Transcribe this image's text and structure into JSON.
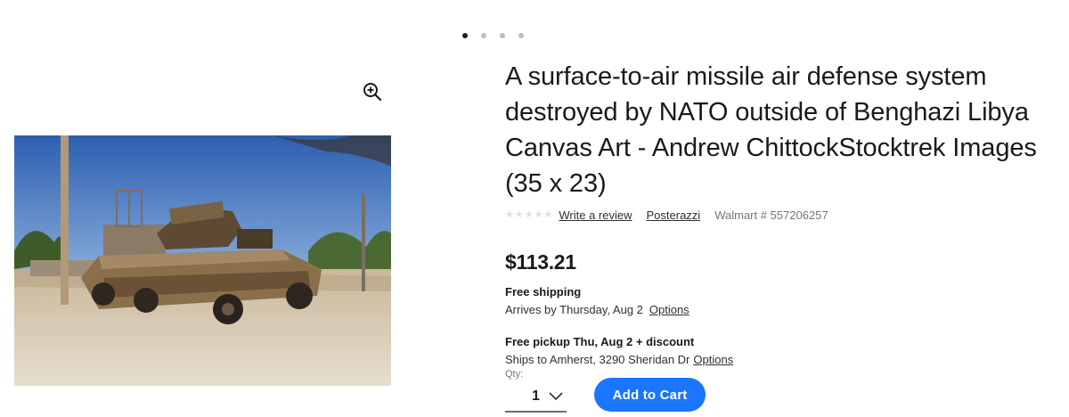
{
  "carousel": {
    "count": 4,
    "active_index": 0
  },
  "icons": {
    "zoom": "zoom-in-icon",
    "qty_chevron": "chevron-down-icon",
    "rating": "star-icon"
  },
  "product": {
    "title": "A surface-to-air missile air defense system destroyed by NATO outside of Benghazi Libya Canvas Art - Andrew ChittockStocktrek Images (35 x 23)",
    "rating_stars": 0,
    "write_review": "Write a review",
    "seller": "Posterazzi",
    "sku": "Walmart # 557206257",
    "price": "$113.21"
  },
  "shipping": {
    "label": "Free shipping",
    "arrives": "Arrives by Thursday, Aug 2",
    "options": "Options"
  },
  "pickup": {
    "label": "Free pickup Thu, Aug 2 + discount",
    "ships_to": "Ships to Amherst, 3290 Sheridan Dr",
    "options": "Options"
  },
  "quantity": {
    "label": "Qty:",
    "value": "1"
  },
  "cart": {
    "button": "Add to Cart"
  },
  "colors": {
    "accent": "#1a75ff",
    "text": "#2e2f32",
    "muted": "#74767c"
  }
}
